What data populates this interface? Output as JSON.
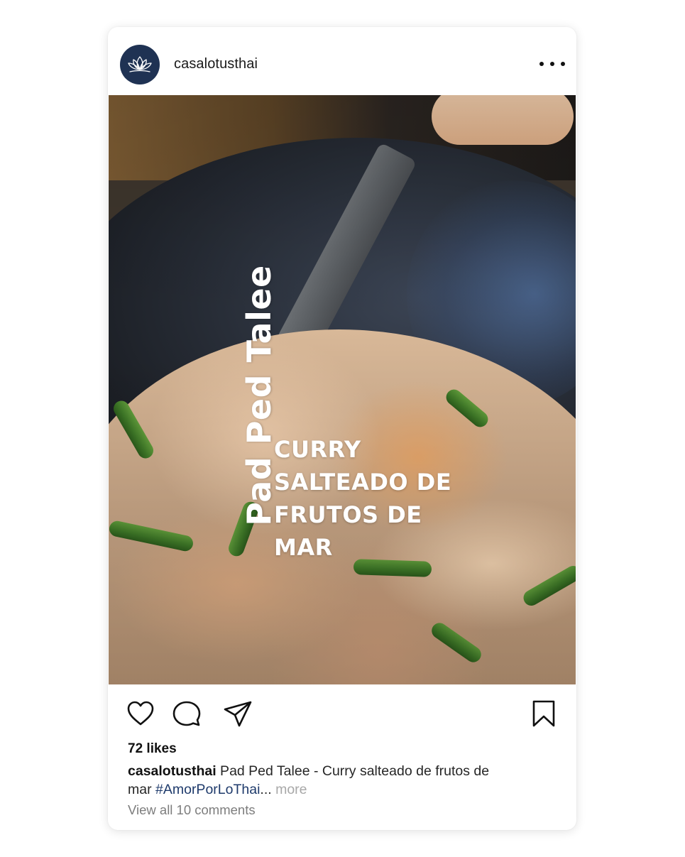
{
  "post": {
    "username": "casalotusthai",
    "avatar_icon": "lotus-icon",
    "avatar_color": "#1f3253",
    "more_icon": "more-options-icon"
  },
  "media": {
    "title_vertical": "Pad Ped Talee",
    "subtitle_lines": [
      "CURRY",
      "SALTEADO DE",
      "FRUTOS DE",
      "MAR"
    ]
  },
  "actions": {
    "like_icon": "heart-icon",
    "comment_icon": "comment-icon",
    "share_icon": "share-icon",
    "save_icon": "bookmark-icon"
  },
  "likes": "72 likes",
  "caption": {
    "username": "casalotusthai",
    "text_line1": " Pad Ped Talee - Curry salteado de frutos de",
    "text_line2_prefix": "mar ",
    "hashtag": "#AmorPorLoThai",
    "ellipsis": "...",
    "more": " more"
  },
  "comments_link": "View all 10 comments"
}
